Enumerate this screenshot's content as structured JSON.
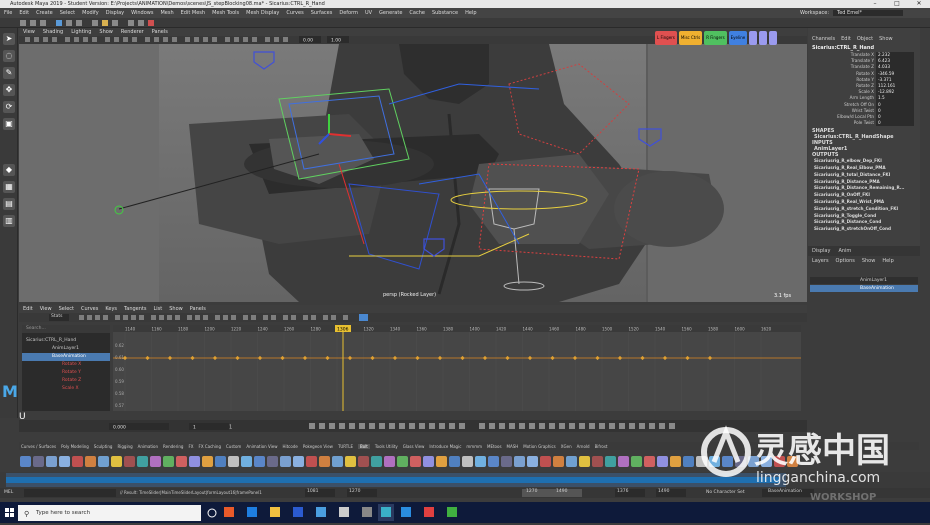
{
  "titlebar": {
    "text": "Autodesk Maya 2019 - Student Version: E:\\Projects\\ANIMATION\\Demos\\scenes\\JS_stepBlocking08.ma* - Sicarius:CTRL_R_Hand"
  },
  "menus": [
    "File",
    "Edit",
    "Create",
    "Select",
    "Modify",
    "Display",
    "Windows",
    "Mesh",
    "Edit Mesh",
    "Mesh Tools",
    "Mesh Display",
    "Curves",
    "Surfaces",
    "Deform",
    "UV",
    "Generate",
    "Cache",
    "Substance",
    "Help"
  ],
  "workspace": {
    "label": "Workspace:",
    "value": "Ted Emel*"
  },
  "viewport_menu": [
    "View",
    "Shading",
    "Lighting",
    "Show",
    "Renderer",
    "Panels"
  ],
  "viewport_field": {
    "a": "0.00",
    "b": "1.00"
  },
  "viewport_buttons": [
    {
      "label": "L Fingers",
      "color": "#e05050"
    },
    {
      "label": "Misc Ctrls",
      "color": "#f0b030"
    },
    {
      "label": "R Fingers",
      "color": "#50c060"
    },
    {
      "label": "Eyeline",
      "color": "#4080e0"
    }
  ],
  "viewport_camera": "persp (Rocked Layer)",
  "fps": "3.1 fps",
  "graph_menu": [
    "Edit",
    "View",
    "Select",
    "Curves",
    "Keys",
    "Tangents",
    "List",
    "Show",
    "Panels"
  ],
  "graph_stats": "Stats",
  "frames": {
    "ticks": [
      "1140",
      "1160",
      "1180",
      "1200",
      "1220",
      "1240",
      "1260",
      "1280",
      "1300",
      "1320",
      "1340",
      "1360",
      "1380",
      "1400",
      "1420",
      "1440",
      "1460",
      "1480",
      "1500",
      "1520",
      "1540",
      "1560",
      "1580",
      "1600",
      "1620"
    ],
    "current": "1306",
    "left": "1081",
    "right": "1270"
  },
  "graph_values": [
    "0.62",
    "0.61",
    "0.60",
    "0.59",
    "0.58",
    "0.57"
  ],
  "outliner": {
    "search": "Search...",
    "rows": [
      "Sicarius:CTRL_R_Hand",
      "AnimLayer1",
      "BaseAnimation",
      "Rotate X",
      "Rotate Y",
      "Rotate Z",
      "Scale X"
    ]
  },
  "channel_box": {
    "tabs": [
      "Channels",
      "Edit",
      "Object",
      "Show"
    ],
    "node": "Sicarius:CTRL_R_Hand",
    "channels": [
      {
        "name": "Translate X",
        "value": "2.232"
      },
      {
        "name": "Translate Y",
        "value": "6.423"
      },
      {
        "name": "Translate Z",
        "value": "4.033"
      },
      {
        "name": "Rotate X",
        "value": "-346.59"
      },
      {
        "name": "Rotate Y",
        "value": "-3.371"
      },
      {
        "name": "Rotate Z",
        "value": "112.161"
      },
      {
        "name": "Scale X",
        "value": "-12.892"
      },
      {
        "name": "Arm Length",
        "value": "1.5"
      },
      {
        "name": "Stretch Off On",
        "value": "0"
      },
      {
        "name": "Wrist Twist",
        "value": "0"
      },
      {
        "name": "Elbow/d Local Ptn",
        "value": "0"
      },
      {
        "name": "Pole Twist",
        "value": "0"
      }
    ],
    "shapes_label": "SHAPES",
    "shape": "Sicarius:CTRL_R_HandShape",
    "inputs_label": "INPUTS",
    "input": "AnimLayer1",
    "outputs_label": "OUTPUTS",
    "outputs": [
      "Sicariusrig_R_elbow_Dep_FKI",
      "Sicariusrig_R_Real_Elbow_PMA",
      "Sicariusrig_R_total_Distance_FKI",
      "Sicariusrig_R_Distance_PMA",
      "Sicariusrig_R_Distance_Remaining_R...",
      "Sicariusrig_R_OnOff_FKI",
      "Sicariusrig_R_Real_Wrist_PMA",
      "Sicariusrig_R_stretch_Condition_FKI",
      "Sicariusrig_R_Toggle_Cond",
      "Sicariusrig_R_Distance_Cond",
      "Sicariusrig_R_stretchOnOff_Cond"
    ]
  },
  "layers": {
    "tabs": [
      "Display",
      "Anim"
    ],
    "menu": [
      "Layers",
      "Options",
      "Show",
      "Help"
    ],
    "rows": [
      {
        "label": "AnimLayer1",
        "active": false
      },
      {
        "label": "BaseAnimation",
        "active": true
      }
    ]
  },
  "timeslider": {
    "start": "0.000",
    "step": "1",
    "end": "1"
  },
  "shelf_tabs": [
    "Curves / Surfaces",
    "Poly Modeling",
    "Sculpting",
    "Rigging",
    "Animation",
    "Rendering",
    "FX",
    "FX Caching",
    "Custom",
    "Animation View",
    "Hitcode",
    "Pokegeon View",
    "TURTLE",
    "Bolt",
    "Tools Utility",
    "Glass View",
    "Introduce Magic",
    "mmmm",
    "MEtoos",
    "MASH",
    "Motion Graphics",
    "XGen",
    "Arnold",
    "Bifrost"
  ],
  "shelf_active": "Bolt",
  "range": {
    "a": "1081",
    "b": "1270",
    "c": "1270",
    "d": "1490",
    "e": "1376",
    "f": "1490"
  },
  "no_char": "No Character Set",
  "anim_layer": "BaseAnimation",
  "mel": "MEL",
  "script_result": "// Result: TimeSlider|MainTimeSliderLayout|formLayout16|framePanel1",
  "taskbar": {
    "search": "Type here to search"
  },
  "watermark": {
    "title": "灵感中国",
    "url": "lingganchina.com",
    "brand": "WORKSHOP"
  }
}
